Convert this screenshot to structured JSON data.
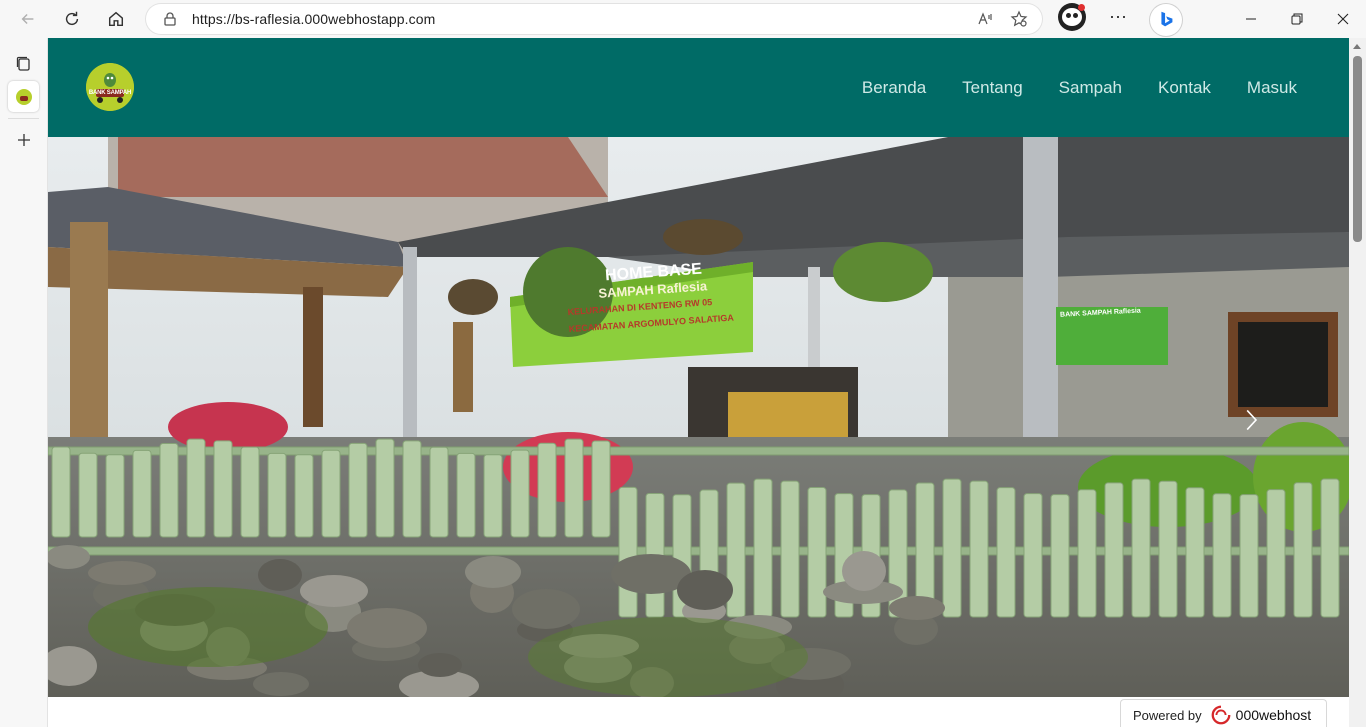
{
  "browser": {
    "url": "https://bs-raflesia.000webhostapp.com",
    "back_icon": "back-arrow-icon",
    "refresh_icon": "refresh-icon",
    "home_icon": "home-icon"
  },
  "site": {
    "logo_text": "BANK SAMPAH",
    "header_color": "#006b66",
    "nav": [
      "Beranda",
      "Tentang",
      "Sampah",
      "Kontak",
      "Masuk"
    ]
  },
  "hero": {
    "banner_lines": [
      "HOME BASE",
      "SAMPAH Raflesia",
      "KELURAHAN DI KENTENG RW 05",
      "KECAMATAN ARGOMULYO SALATIGA"
    ],
    "wall_sign_text": "BANK SAMPAH Raflesia"
  },
  "footer": {
    "powered_label": "Powered by",
    "powered_brand": "000webhost"
  }
}
